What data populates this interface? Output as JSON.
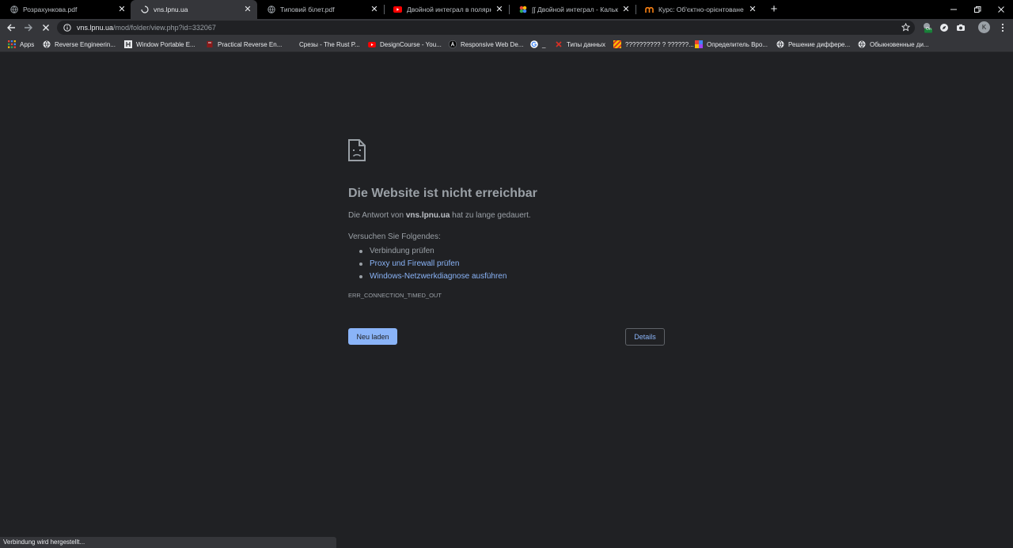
{
  "tabs": [
    {
      "label": "Розрахункова.pdf",
      "icon": "globe-icon",
      "active": false
    },
    {
      "label": "vns.lpnu.ua",
      "icon": "loading-spinner-icon",
      "active": true
    },
    {
      "label": "Типовий білет.pdf",
      "icon": "globe-icon",
      "active": false
    },
    {
      "label": "Двойной интеграл в полярных",
      "icon": "youtube-icon",
      "active": false
    },
    {
      "label": "∫∫ Двойной интеграл - Калькуля",
      "icon": "calculator-icon",
      "active": false
    },
    {
      "label": "Курс: Об'єктно-орієнтоване про",
      "icon": "moodle-icon",
      "active": false
    }
  ],
  "tab_close_glyph": "✕",
  "new_tab_glyph": "+",
  "address": {
    "host": "vns.lpnu.ua",
    "path": "/mod/folder/view.php?id=332067"
  },
  "bookmarks": [
    {
      "label": "Apps",
      "icon": "apps-grid-icon"
    },
    {
      "label": "Reverse Engineerin...",
      "icon": "globe-icon"
    },
    {
      "label": "Window Portable E...",
      "icon": "h-logo-icon"
    },
    {
      "label": "Practical Reverse En...",
      "icon": "book-icon"
    },
    {
      "label": "Срезы - The Rust P...",
      "icon": "none"
    },
    {
      "label": "DesignCourse - You...",
      "icon": "youtube-icon"
    },
    {
      "label": "Responsive Web De...",
      "icon": "a-logo-icon"
    },
    {
      "label": "_",
      "icon": "google-icon"
    },
    {
      "label": "Типы данных",
      "icon": "x-logo-icon"
    },
    {
      "label": "?????????? ? ??????...",
      "icon": "stripes-icon"
    },
    {
      "label": "Определитель Вро...",
      "icon": "colorful-logo-icon"
    },
    {
      "label": "Решение диффере...",
      "icon": "globe-icon"
    },
    {
      "label": "Обыкновенные ди...",
      "icon": "globe-icon"
    }
  ],
  "error": {
    "title": "Die Website ist nicht erreichbar",
    "message_prefix": "Die Antwort von ",
    "message_host": "vns.lpnu.ua",
    "message_suffix": " hat zu lange gedauert.",
    "try_heading": "Versuchen Sie Folgendes:",
    "suggestions": [
      {
        "text": "Verbindung prüfen",
        "link": false
      },
      {
        "text": "Proxy und Firewall prüfen",
        "link": true
      },
      {
        "text": "Windows-Netzwerkdiagnose ausführen",
        "link": true
      }
    ],
    "code": "ERR_CONNECTION_TIMED_OUT",
    "reload_label": "Neu laden",
    "details_label": "Details"
  },
  "profile_initial": "K",
  "extension_badge": "On",
  "status_text": "Verbindung wird hergestellt...",
  "colors": {
    "background": "#202124",
    "toolbar": "#35363a",
    "link": "#8ab4f8",
    "text": "#9aa0a6"
  }
}
